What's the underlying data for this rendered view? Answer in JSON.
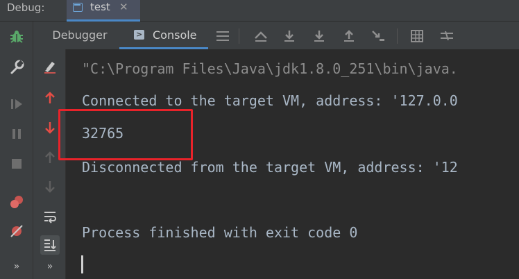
{
  "debug_bar": {
    "label": "Debug:",
    "tab_label": "test",
    "tab_close": "✕"
  },
  "tabs": {
    "debugger": "Debugger",
    "console": "Console"
  },
  "console": {
    "lines": [
      "\"C:\\Program Files\\Java\\jdk1.8.0_251\\bin\\java.",
      "Connected to the target VM, address: '127.0.0",
      "32765",
      "Disconnected from the target VM, address: '12",
      "",
      "Process finished with exit code 0"
    ]
  },
  "left_strip": {
    "more": "»"
  },
  "console_toolbar": {
    "more": "»"
  },
  "colors": {
    "text": "#a9b7c6",
    "highlight_border": "#e8232a",
    "accent": "#4a88c7",
    "bug_green": "#59a869",
    "stop_red": "#c75450"
  }
}
